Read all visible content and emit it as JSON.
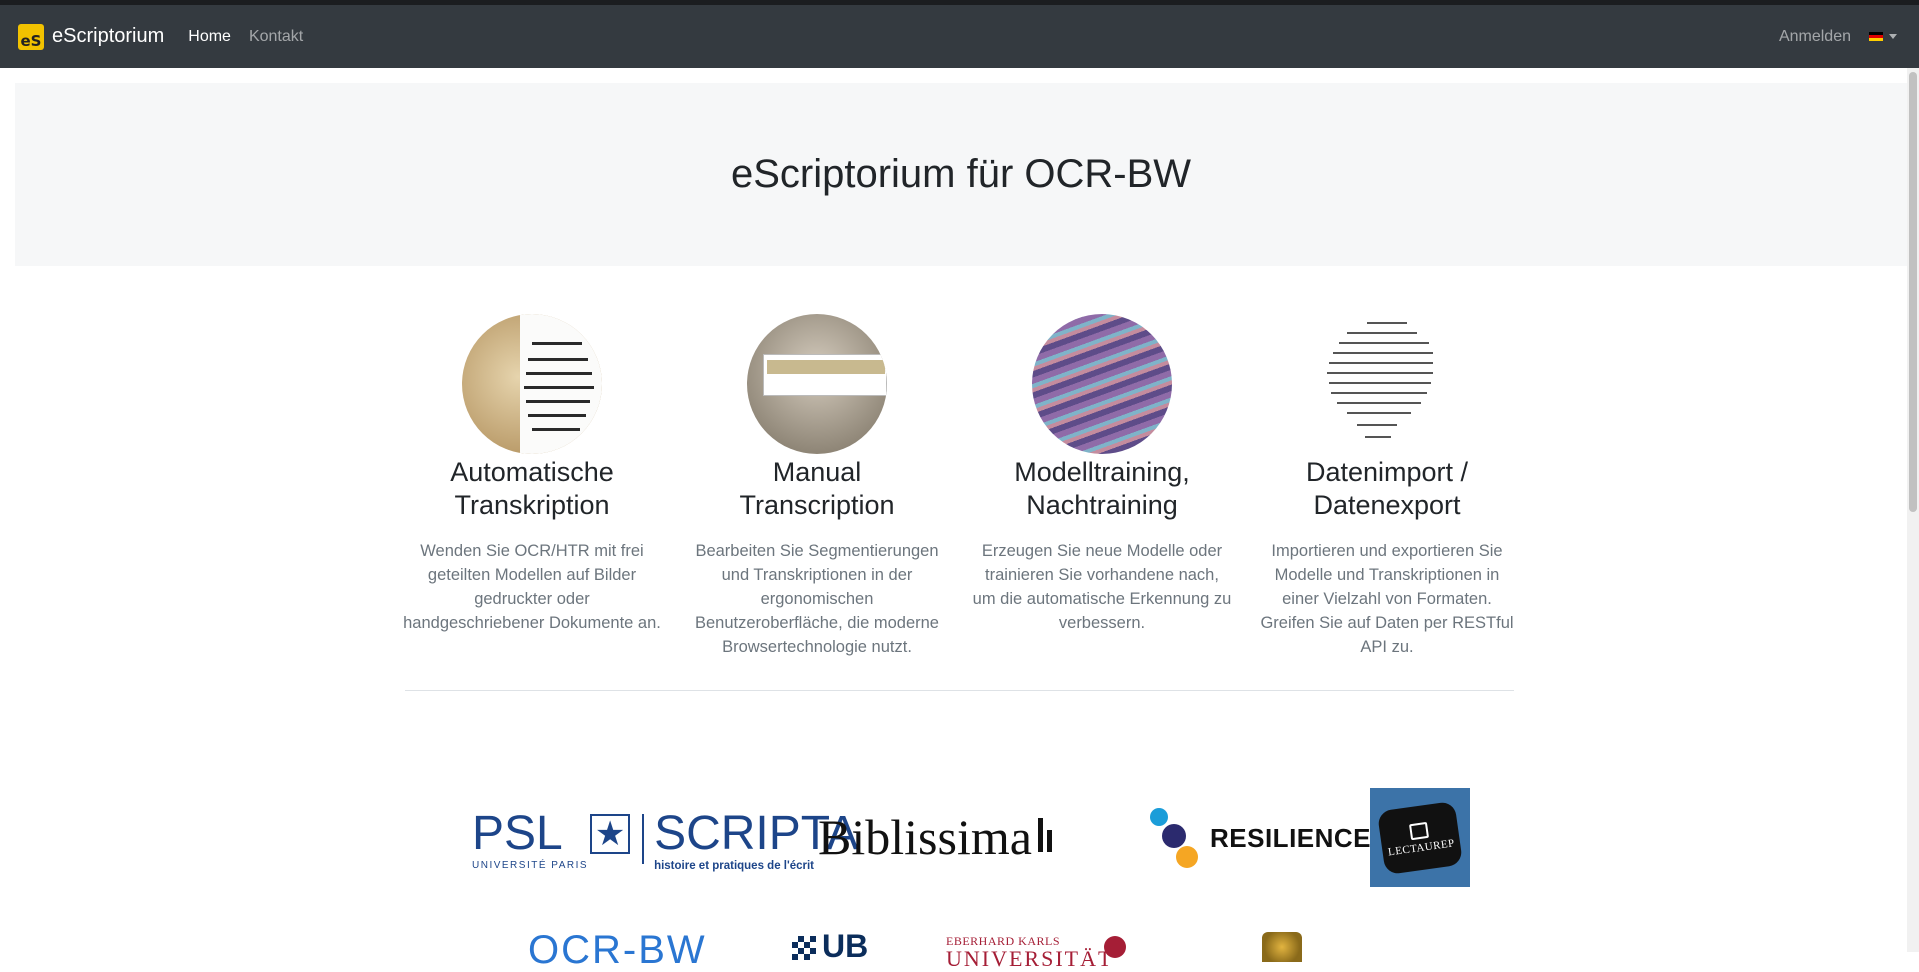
{
  "navbar": {
    "brand_logo_text": "eS",
    "brand": "eScriptorium",
    "links": [
      "Home",
      "Kontakt"
    ],
    "login": "Anmelden",
    "language_flag": "de-flag-icon"
  },
  "hero": {
    "title": "eScriptorium für OCR-BW"
  },
  "features": [
    {
      "title_1": "Automatische",
      "title_2": "Transkription",
      "text": "Wenden Sie OCR/HTR mit frei geteilten Modellen auf Bilder gedruckter oder handgeschriebener Dokumente an."
    },
    {
      "title_1": "Manual",
      "title_2": "Transcription",
      "text": "Bearbeiten Sie Segmentierungen und Transkriptionen in der ergonomischen Benutzeroberfläche, die moderne Browsertechnologie nutzt."
    },
    {
      "title_1": "Modelltraining,",
      "title_2": "Nachtraining",
      "text": "Erzeugen Sie neue Modelle oder trainieren Sie vorhandene nach, um die automatische Erkennung zu verbessern."
    },
    {
      "title_1": "Datenimport /",
      "title_2": "Datenexport",
      "text": "Importieren und exportieren Sie Modelle und Transkriptionen in einer Vielzahl von Formaten. Greifen Sie auf Daten per RESTful API zu."
    }
  ],
  "partners": {
    "psl": {
      "big": "PSL",
      "sub": "UNIVERSITÉ PARIS"
    },
    "scripta": {
      "big": "SCRIPTA",
      "sub": "histoire et pratiques de l'écrit"
    },
    "biblissima": "Biblissima",
    "resilience": "RESILIENCE",
    "lectaurep": "LECTAUREP",
    "ocrbw": "OCR-BW",
    "ub": "UB",
    "tuebingen": {
      "line1": "EBERHARD KARLS",
      "line2": "UNIVERSITÄT"
    }
  },
  "colors": {
    "navbar_bg": "#343a40",
    "hero_bg": "#f6f7f8",
    "brand_yellow": "#f2c200",
    "psl_blue": "#1d4589",
    "ocrbw_blue": "#2a76d2",
    "tuebingen_red": "#a51e36",
    "lectaurep_blue": "#3c73a8"
  }
}
